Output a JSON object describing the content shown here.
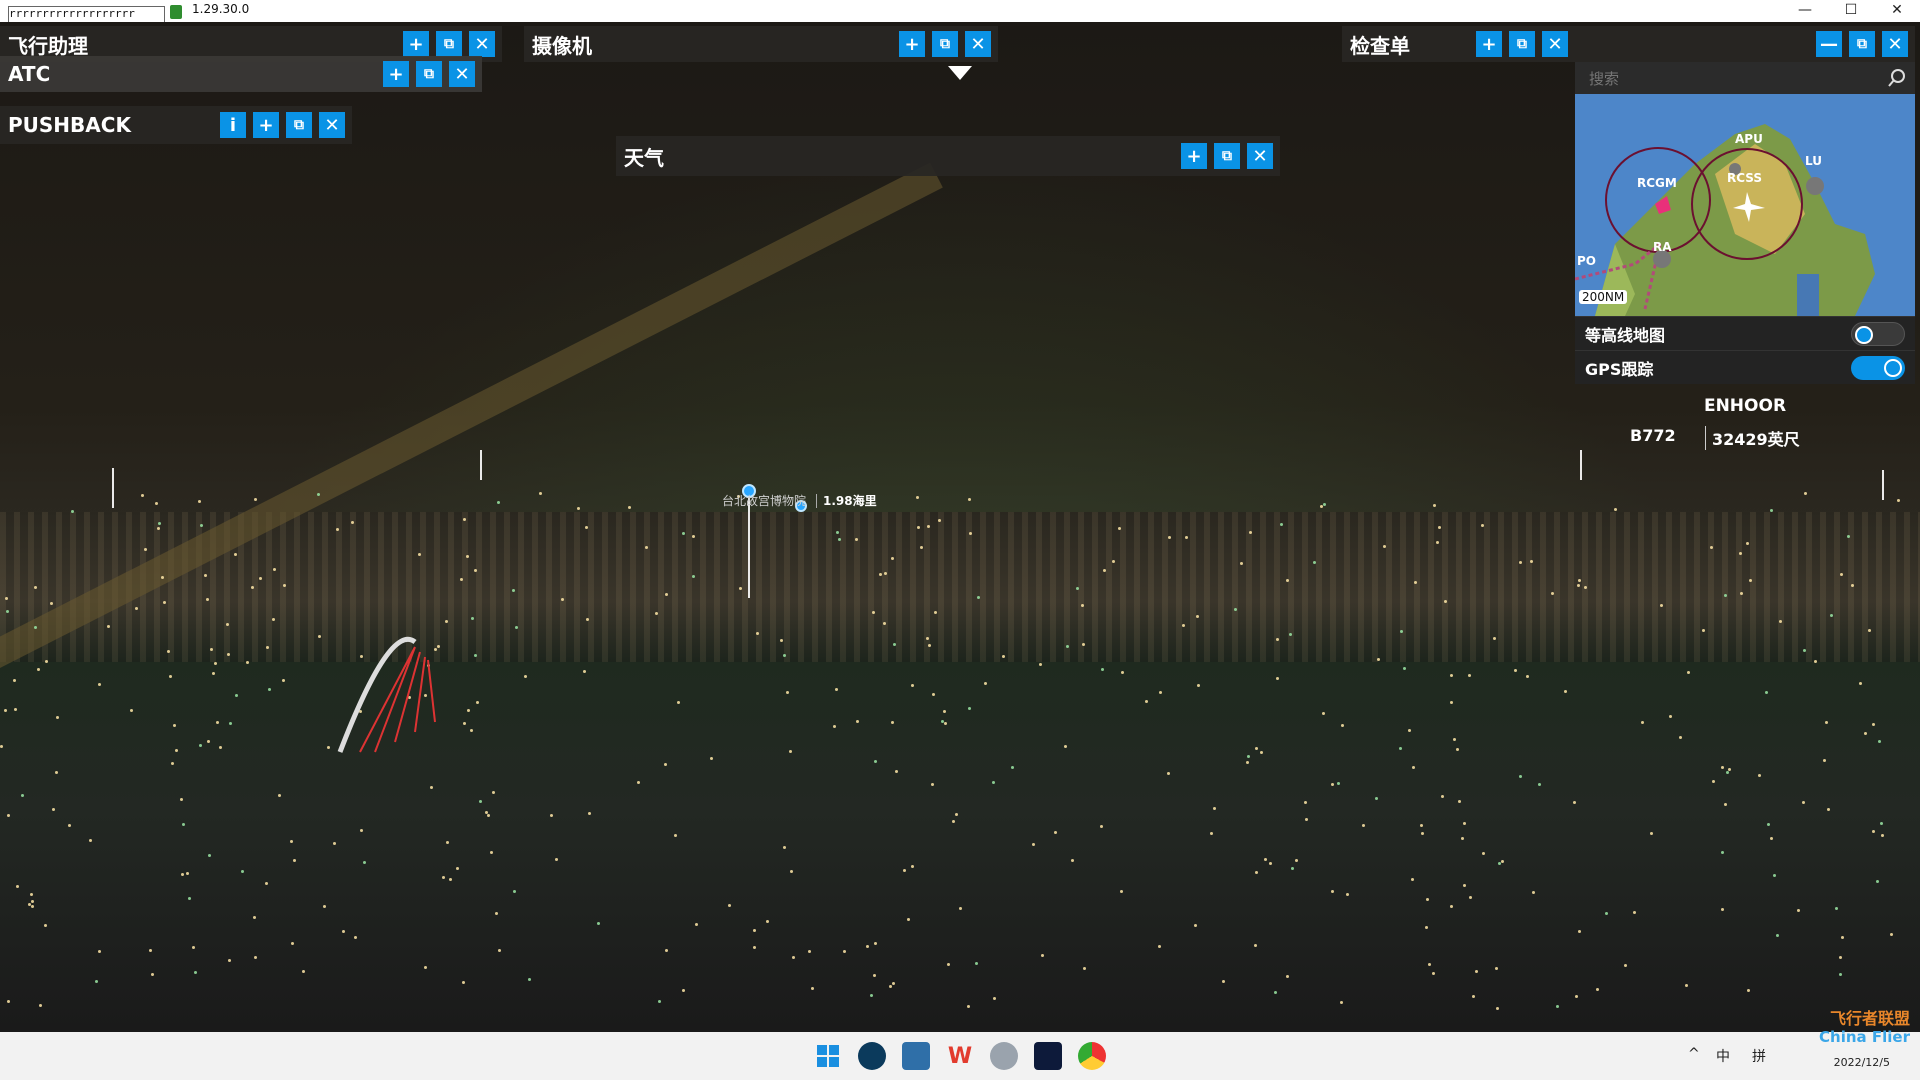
{
  "window": {
    "field_text": "rrrrrrrrrrrrrrrrrrr",
    "version": "1.29.30.0",
    "min": "—",
    "max": "☐",
    "close": "✕"
  },
  "panels": {
    "flight_assist": {
      "title": "飞行助理"
    },
    "atc": {
      "title": "ATC"
    },
    "pushback": {
      "title": "PUSHBACK",
      "info": "i"
    },
    "camera": {
      "title": "摄像机"
    },
    "weather": {
      "title": "天气"
    },
    "checklist": {
      "title": "检查单"
    },
    "btn_add": "+",
    "btn_open": "⧉",
    "btn_close": "✕",
    "btn_min": "—"
  },
  "poi": {
    "name": "台北故宫博物院",
    "distance": "1.98海里"
  },
  "map": {
    "search_placeholder": "搜索",
    "scale": "200NM",
    "labels": {
      "apu": "APU",
      "lu": "LU",
      "rcgm": "RCGM",
      "rcss": "RCSS",
      "ra": "RA",
      "po": "PO"
    },
    "contour_label": "等高线地图",
    "contour_on": false,
    "gps_label": "GPS跟踪",
    "gps_on": true
  },
  "aircraft": {
    "callsign": "ENHOOR",
    "type": "B772",
    "altitude": "32429英尺"
  },
  "taskbar": {
    "icons": [
      "windows-icon",
      "cortana-icon",
      "photos-icon",
      "wps-icon",
      "globe-icon",
      "flightsim-icon",
      "chrome-icon"
    ],
    "tray": [
      "^",
      "中",
      "拼"
    ],
    "date": "2022/12/5"
  },
  "watermark": {
    "cn": "飞行者联盟",
    "en": "China Flier"
  },
  "colors": {
    "accent": "#0a93e6",
    "panel_bg": "#282624"
  }
}
